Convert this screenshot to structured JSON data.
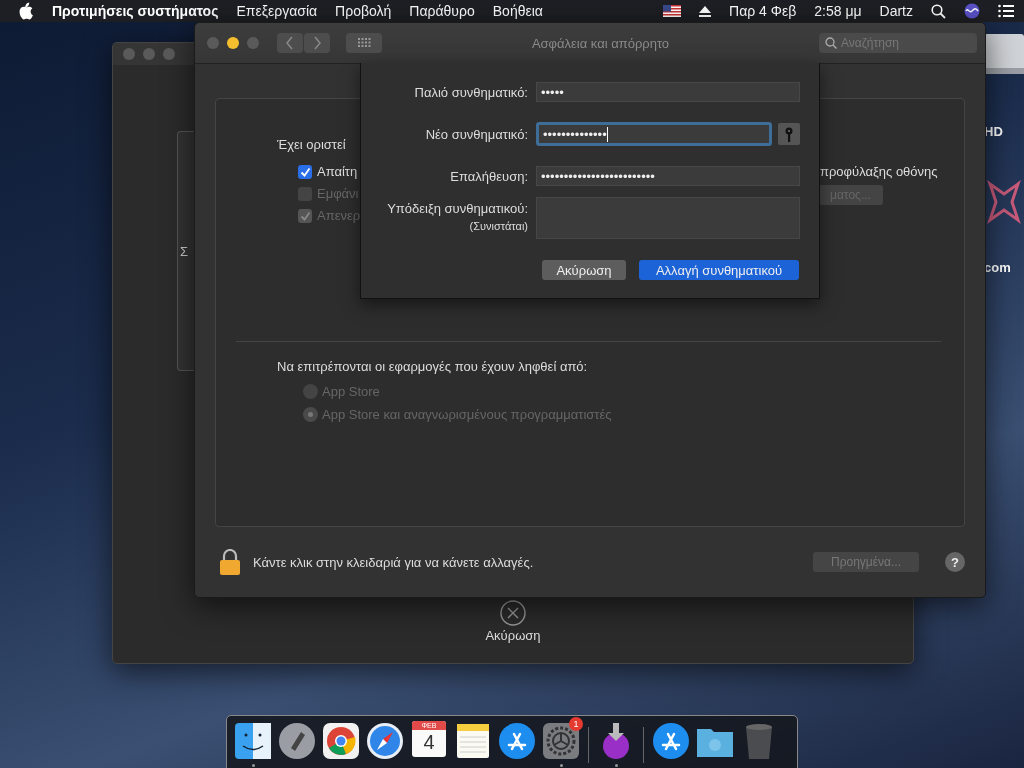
{
  "menu_bar": {
    "app_name": "Προτιμήσεις συστήματος",
    "menus": [
      "Επεξεργασία",
      "Προβολή",
      "Παράθυρο",
      "Βοήθεια"
    ],
    "date": "Παρ 4 Φεβ",
    "time": "2:58 μμ",
    "user": "Dartz"
  },
  "desktop_labels": [
    "HD",
    "com"
  ],
  "back_window": {
    "fragment_letter": "Σ",
    "cancel_label": "Ακύρωση"
  },
  "window": {
    "title": "Ασφάλεια και απόρρητο",
    "search_placeholder": "Αναζήτηση",
    "password_heading": "Έχει οριστεί",
    "options": [
      {
        "label": "Απαίτη",
        "checked": true,
        "disabled": false
      },
      {
        "label": "Εμφάνι",
        "checked": false,
        "disabled": true
      },
      {
        "label": "Απενερ",
        "checked": true,
        "disabled": true
      }
    ],
    "option_suffix": "προφύλαξης οθόνης",
    "option_button": "ματος...",
    "downloads_heading": "Να επιτρέπονται οι εφαρμογές που έχουν ληφθεί από:",
    "sources": [
      {
        "label": "App Store",
        "selected": false,
        "disabled": true
      },
      {
        "label": "App Store και αναγνωρισμένους προγραμματιστές",
        "selected": true,
        "disabled": true
      }
    ],
    "lock_text": "Κάντε κλικ στην κλειδαριά για να κάνετε αλλαγές.",
    "advanced_button": "Προηγμένα...",
    "advanced_disabled": true,
    "help_label": "?"
  },
  "sheet": {
    "fields": [
      {
        "kind": "password",
        "label": "Παλιό συνθηματικό:",
        "value": "•••••",
        "focused": false,
        "key_button": false
      },
      {
        "kind": "password",
        "label": "Νέο συνθηματικό:",
        "value": "••••••••••••••",
        "focused": true,
        "key_button": true
      },
      {
        "kind": "password",
        "label": "Επαλήθευση:",
        "value": "•••••••••••••••••••••••••",
        "focused": false,
        "key_button": false
      },
      {
        "kind": "hint",
        "label": "Υπόδειξη συνθηματικού:",
        "note": "(Συνιστάται)",
        "focused": false,
        "key_button": false
      }
    ],
    "buttons": [
      {
        "label": "Ακύρωση",
        "default": false
      },
      {
        "label": "Αλλαγή συνθηματικού",
        "default": true
      }
    ]
  },
  "dock": {
    "items": [
      {
        "kind": "finder",
        "running": true
      },
      {
        "kind": "launchpad",
        "running": false
      },
      {
        "kind": "chrome",
        "running": false
      },
      {
        "kind": "safari",
        "running": false
      },
      {
        "kind": "calendar",
        "running": false,
        "month": "ΦΕΒ",
        "day": "4"
      },
      {
        "kind": "notes",
        "running": false
      },
      {
        "kind": "appstore",
        "running": false
      },
      {
        "kind": "preferences",
        "running": true,
        "badge": "1"
      },
      {
        "kind": "separator"
      },
      {
        "kind": "installer",
        "running": true
      },
      {
        "kind": "separator"
      },
      {
        "kind": "appstore",
        "running": false
      },
      {
        "kind": "folder",
        "running": false
      },
      {
        "kind": "trash",
        "running": false
      }
    ]
  }
}
